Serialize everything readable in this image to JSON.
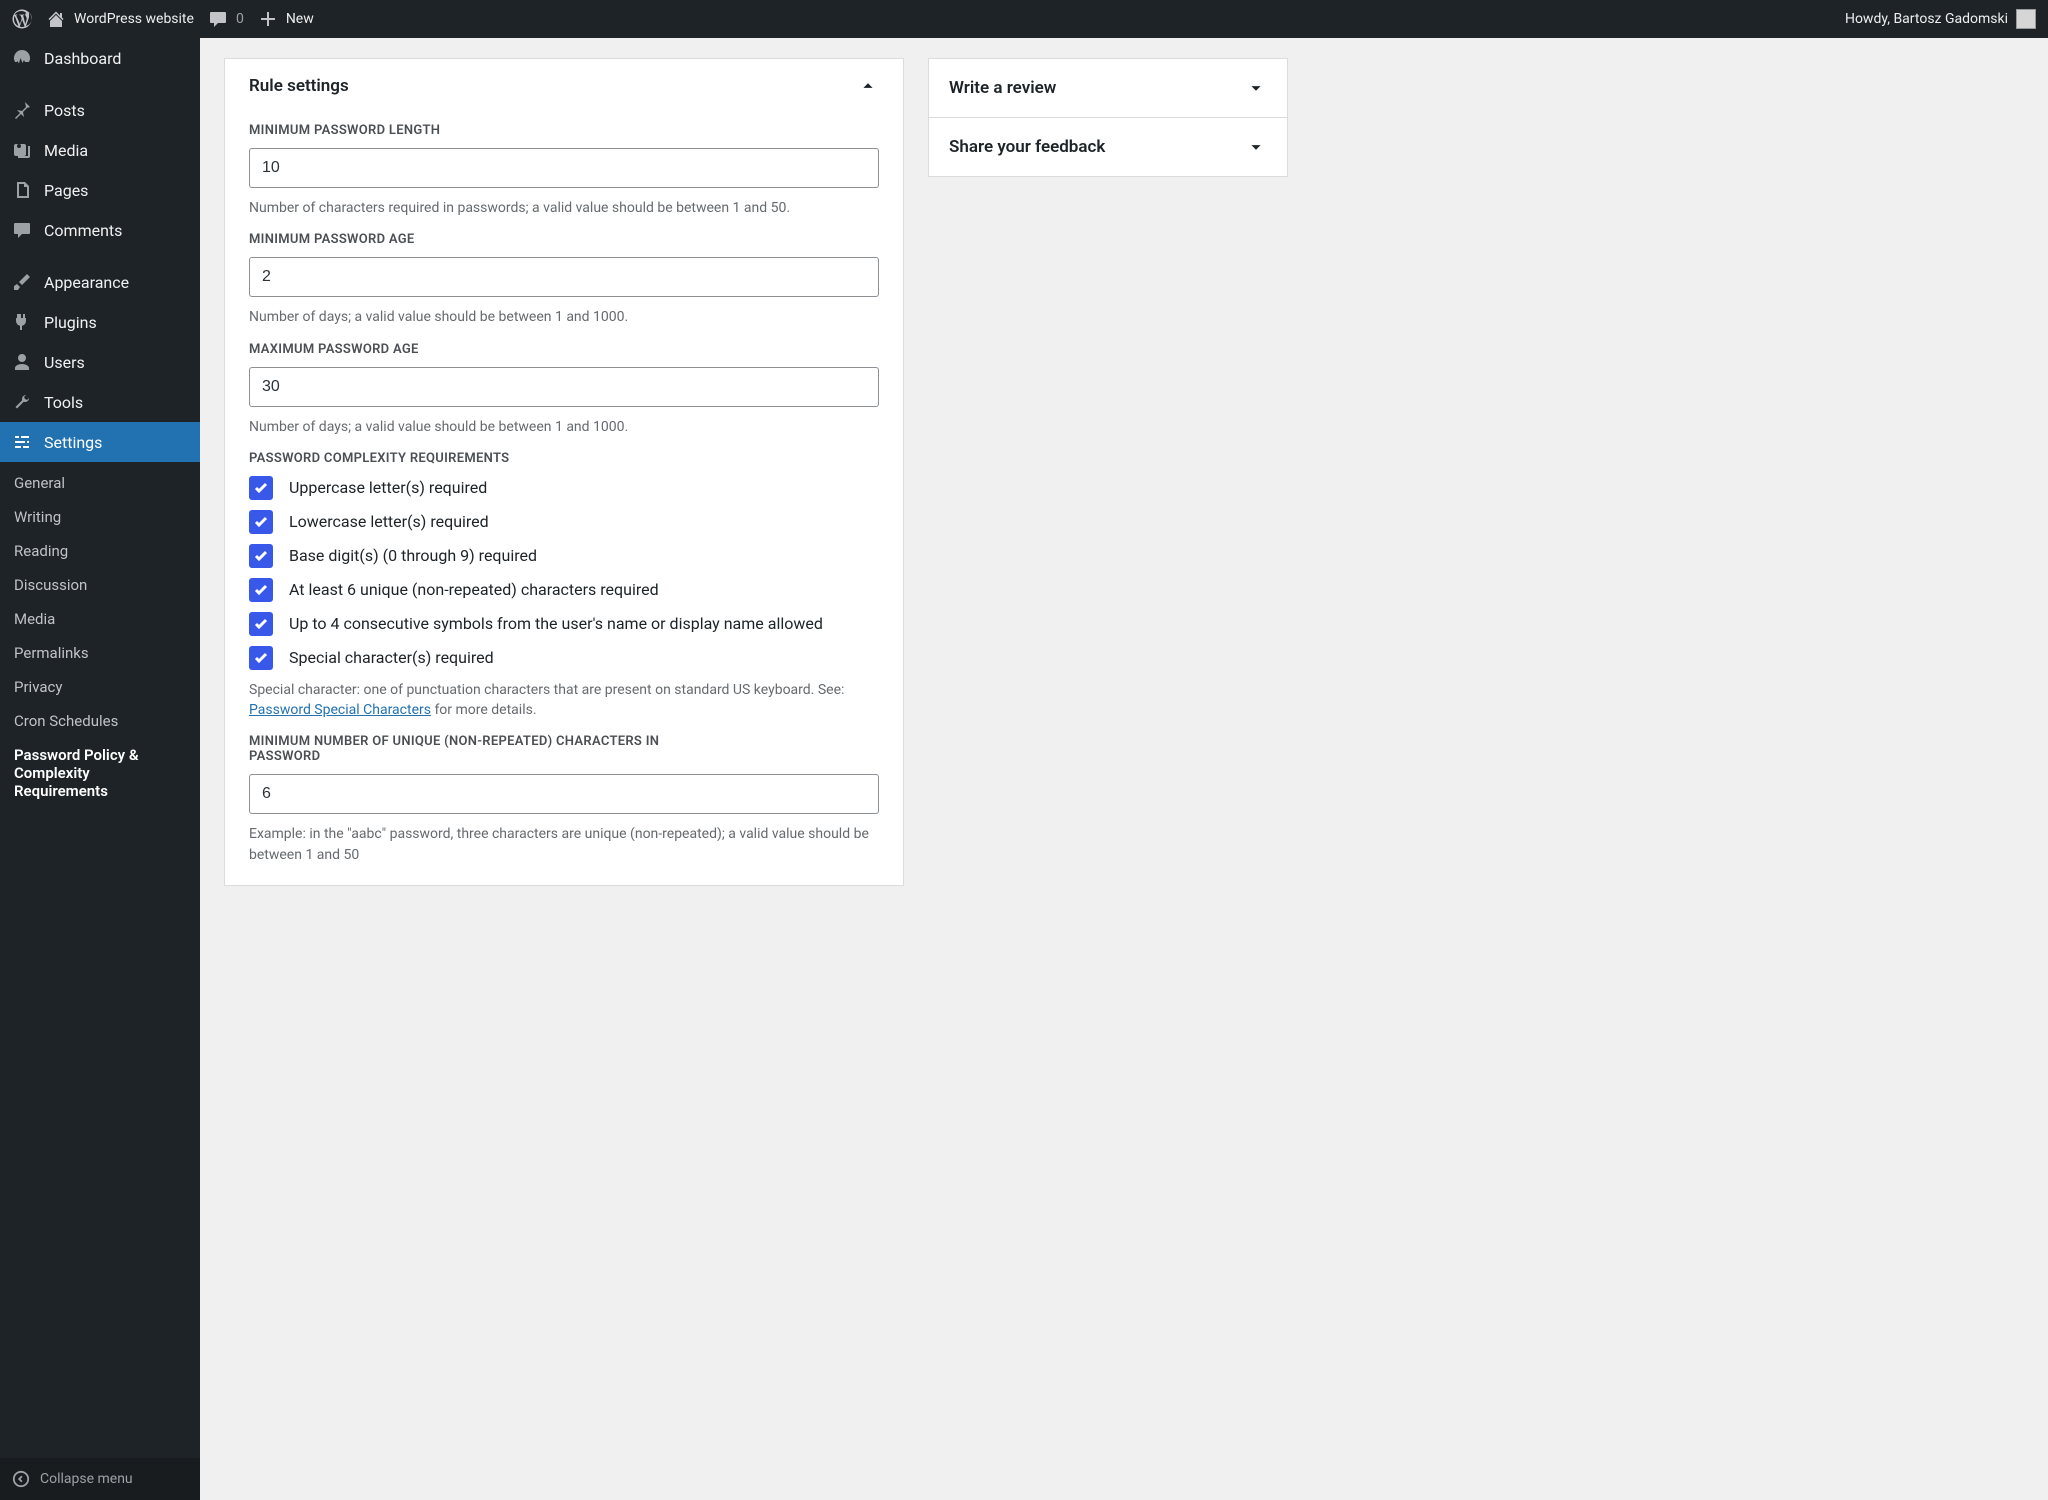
{
  "adminbar": {
    "site_name": "WordPress website",
    "comments_count": "0",
    "new_label": "New",
    "greeting": "Howdy, Bartosz Gadomski"
  },
  "sidebar": {
    "items": [
      {
        "label": "Dashboard"
      },
      {
        "label": "Posts"
      },
      {
        "label": "Media"
      },
      {
        "label": "Pages"
      },
      {
        "label": "Comments"
      },
      {
        "label": "Appearance"
      },
      {
        "label": "Plugins"
      },
      {
        "label": "Users"
      },
      {
        "label": "Tools"
      },
      {
        "label": "Settings"
      }
    ],
    "submenu": [
      {
        "label": "General"
      },
      {
        "label": "Writing"
      },
      {
        "label": "Reading"
      },
      {
        "label": "Discussion"
      },
      {
        "label": "Media"
      },
      {
        "label": "Permalinks"
      },
      {
        "label": "Privacy"
      },
      {
        "label": "Cron Schedules"
      },
      {
        "label": "Password Policy & Complexity Requirements"
      }
    ],
    "collapse_label": "Collapse menu"
  },
  "panel": {
    "title": "Rule settings",
    "fields": {
      "min_len_label": "MINIMUM PASSWORD LENGTH",
      "min_len_value": "10",
      "min_len_help": "Number of characters required in passwords; a valid value should be between 1 and 50.",
      "min_age_label": "MINIMUM PASSWORD AGE",
      "min_age_value": "2",
      "min_age_help": "Number of days; a valid value should be between 1 and 1000.",
      "max_age_label": "MAXIMUM PASSWORD AGE",
      "max_age_value": "30",
      "max_age_help": "Number of days; a valid value should be between 1 and 1000.",
      "complexity_label": "PASSWORD COMPLEXITY REQUIREMENTS",
      "complexity_options": [
        "Uppercase letter(s) required",
        "Lowercase letter(s) required",
        "Base digit(s) (0 through 9) required",
        "At least 6 unique (non-repeated) characters required",
        "Up to 4 consecutive symbols from the user's name or display name allowed",
        "Special character(s) required"
      ],
      "complexity_help_1": "Special character: one of punctuation characters that are present on standard US keyboard. See: ",
      "complexity_help_link": "Password Special Characters",
      "complexity_help_2": " for more details.",
      "unique_label": "MINIMUM NUMBER OF UNIQUE (NON-REPEATED) CHARACTERS IN PASSWORD",
      "unique_value": "6",
      "unique_help": "Example: in the \"aabc\" password, three characters are unique (non-repeated); a valid value should be between 1 and 50"
    }
  },
  "side": {
    "review_label": "Write a review",
    "feedback_label": "Share your feedback"
  }
}
